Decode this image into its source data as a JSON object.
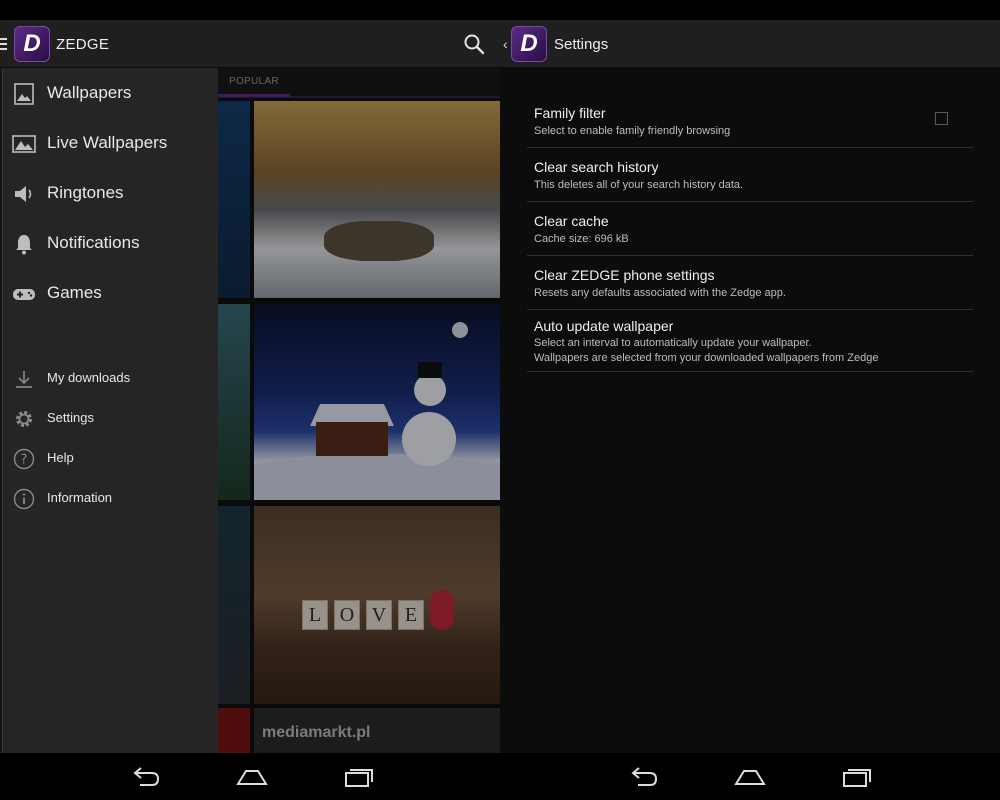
{
  "app": {
    "name": "ZEDGE",
    "logo_letter": "D",
    "accent_color": "#5e2d86"
  },
  "left_screen": {
    "tabs": [
      {
        "label": "POPULAR"
      }
    ],
    "drawer": {
      "primary_items": [
        {
          "label": "Wallpapers",
          "icon": "image-icon"
        },
        {
          "label": "Live Wallpapers",
          "icon": "landscape-icon"
        },
        {
          "label": "Ringtones",
          "icon": "speaker-icon"
        },
        {
          "label": "Notifications",
          "icon": "bell-icon"
        },
        {
          "label": "Games",
          "icon": "gamepad-icon"
        }
      ],
      "secondary_items": [
        {
          "label": "My downloads",
          "icon": "download-icon"
        },
        {
          "label": "Settings",
          "icon": "gear-icon"
        },
        {
          "label": "Help",
          "icon": "help-icon"
        },
        {
          "label": "Information",
          "icon": "info-icon"
        }
      ]
    },
    "thumbnails": {
      "love_letters": [
        "L",
        "O",
        "V",
        "E"
      ],
      "banner_text": "mediamarkt.pl"
    }
  },
  "right_screen": {
    "title": "Settings",
    "preferences": [
      {
        "title": "Family filter",
        "summary": "Select to enable family friendly browsing",
        "checked": false
      },
      {
        "title": "Clear search history",
        "summary": "This deletes all of your search history data."
      },
      {
        "title": "Clear cache",
        "summary": "Cache size: 696 kB"
      },
      {
        "title": "Clear ZEDGE phone settings",
        "summary": "Resets any defaults associated with the Zedge app."
      },
      {
        "title": "Auto update wallpaper",
        "summary": "Select an interval to automatically update your wallpaper.",
        "summary_line2": "Wallpapers are selected from your downloaded wallpapers from Zedge"
      }
    ]
  },
  "navbar": {
    "buttons": [
      "back-icon",
      "home-icon",
      "recents-icon"
    ]
  }
}
